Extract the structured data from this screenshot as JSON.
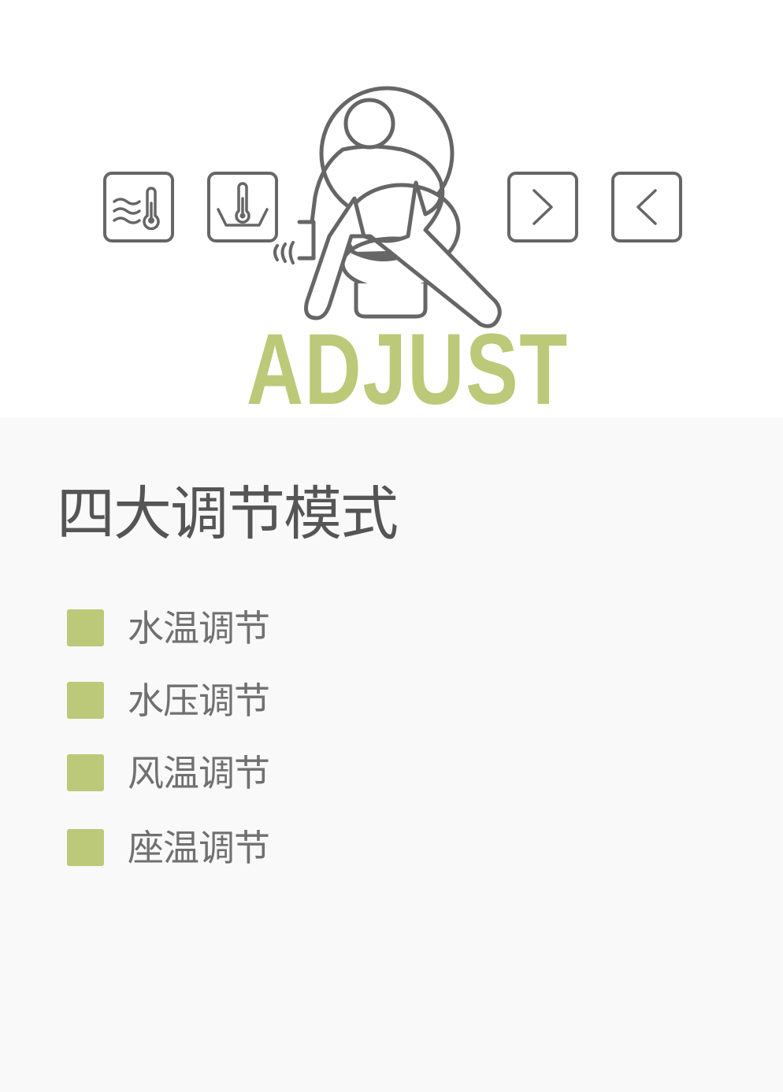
{
  "hero": {
    "word": "ADJUST",
    "icons": [
      "air-temperature-icon",
      "water-temperature-icon",
      "seated-user-illustration",
      "chevron-right-icon",
      "chevron-left-icon"
    ]
  },
  "section": {
    "title": "四大调节模式",
    "items": [
      {
        "label": "水温调节"
      },
      {
        "label": "水压调节"
      },
      {
        "label": "风温调节"
      },
      {
        "label": "座温调节"
      }
    ]
  },
  "colors": {
    "accent": "#bcc978",
    "icon_stroke": "#666666",
    "title_text": "#555555",
    "item_text": "#707070",
    "lower_background": "#f9f9f9"
  }
}
